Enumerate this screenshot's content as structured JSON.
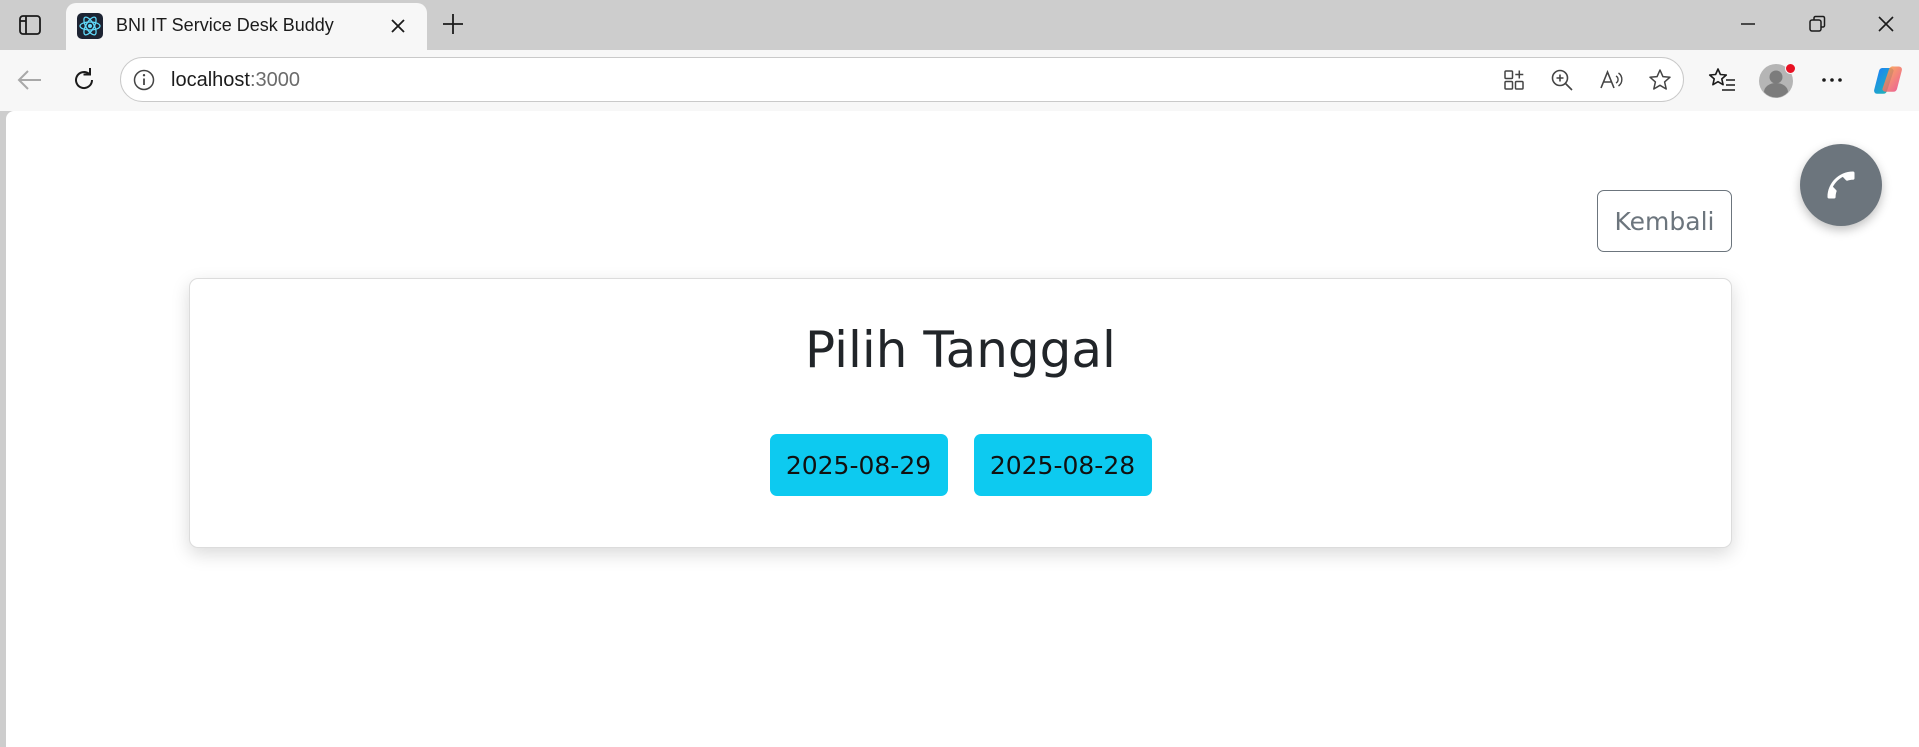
{
  "browser": {
    "tab": {
      "title": "BNI IT Service Desk Buddy",
      "favicon": "react-logo-icon"
    },
    "address": {
      "host": "localhost",
      "port": ":3000"
    },
    "icons": {
      "accent_profile_dot": "#e81123"
    }
  },
  "page": {
    "back_label": "Kembali",
    "call_button": "phone-icon",
    "card": {
      "title": "Pilih Tanggal",
      "dates": [
        "2025-08-29",
        "2025-08-28"
      ]
    },
    "colors": {
      "date_button_bg": "#0dcaf0",
      "secondary": "#6c757d"
    }
  }
}
